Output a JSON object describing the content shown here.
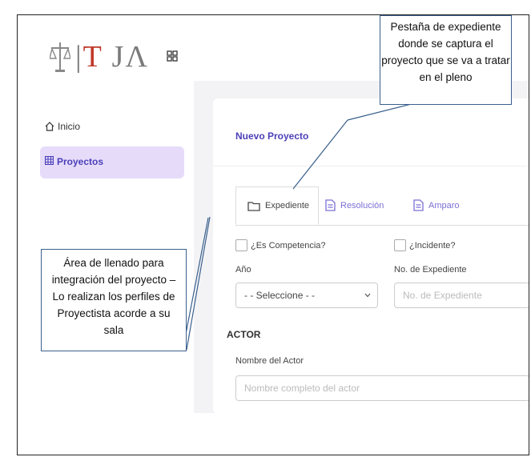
{
  "sidebar": {
    "logo_text": "TJA",
    "items": [
      {
        "label": "Inicio",
        "icon": "home-icon"
      },
      {
        "label": "Proyectos",
        "icon": "table-icon"
      }
    ]
  },
  "card": {
    "title": "Nuevo Proyecto",
    "tabs": [
      {
        "label": "Expediente",
        "icon": "folder-icon",
        "active": true
      },
      {
        "label": "Resolución",
        "icon": "document-icon",
        "active": false
      },
      {
        "label": "Amparo",
        "icon": "document-icon",
        "active": false
      }
    ],
    "checks": {
      "competencia": "¿Es Competencia?",
      "incidente": "¿Incidente?"
    },
    "anio_label": "Año",
    "anio_value": "- - Seleccione - -",
    "expediente_label": "No. de Expediente",
    "expediente_placeholder": "No. de Expediente",
    "section_actor": "ACTOR",
    "actor_label": "Nombre del Actor",
    "actor_placeholder": "Nombre completo del actor"
  },
  "annotations": {
    "tab_note": [
      "Pestaña de expediente",
      "donde se captura el",
      "proyecto que se va a tratar",
      "en el pleno"
    ],
    "area_note": [
      "Área de llenado para",
      "integración del proyecto –",
      "Lo realizan los perfiles de",
      "Proyectista acorde a su",
      "sala"
    ]
  },
  "colors": {
    "accent": "#4b3fb8",
    "active_nav_bg": "#e6dcfa",
    "logo_red": "#c0392b",
    "callout_border": "#3a5f8c"
  }
}
